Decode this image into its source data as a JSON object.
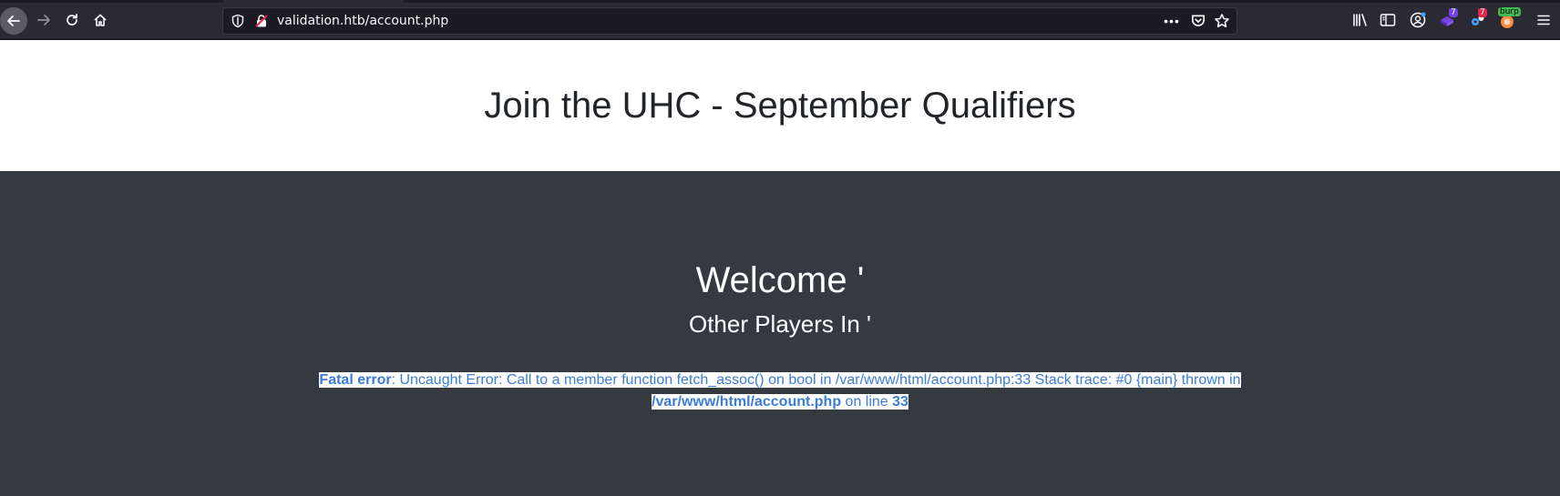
{
  "browser": {
    "url": "validation.htb/account.php",
    "page_actions": "•••",
    "extension_badges": {
      "first": "7",
      "second": "7",
      "burp": "burp"
    }
  },
  "page": {
    "title": "Join the UHC - September Qualifiers",
    "welcome": "Welcome '",
    "players_heading": "Other Players In '",
    "error": {
      "label": "Fatal error",
      "message": ": Uncaught Error: Call to a member function fetch_assoc() on bool in /var/www/html/account.php:33 Stack trace: #0 {main} thrown in ",
      "file": "/var/www/html/account.php",
      "on_line_text": " on line ",
      "line": "33"
    }
  },
  "colors": {
    "toolbar_bg": "#2b2a33",
    "page_bg": "#343a40",
    "header_bg": "#ffffff",
    "error_text": "#3b7dd8"
  }
}
